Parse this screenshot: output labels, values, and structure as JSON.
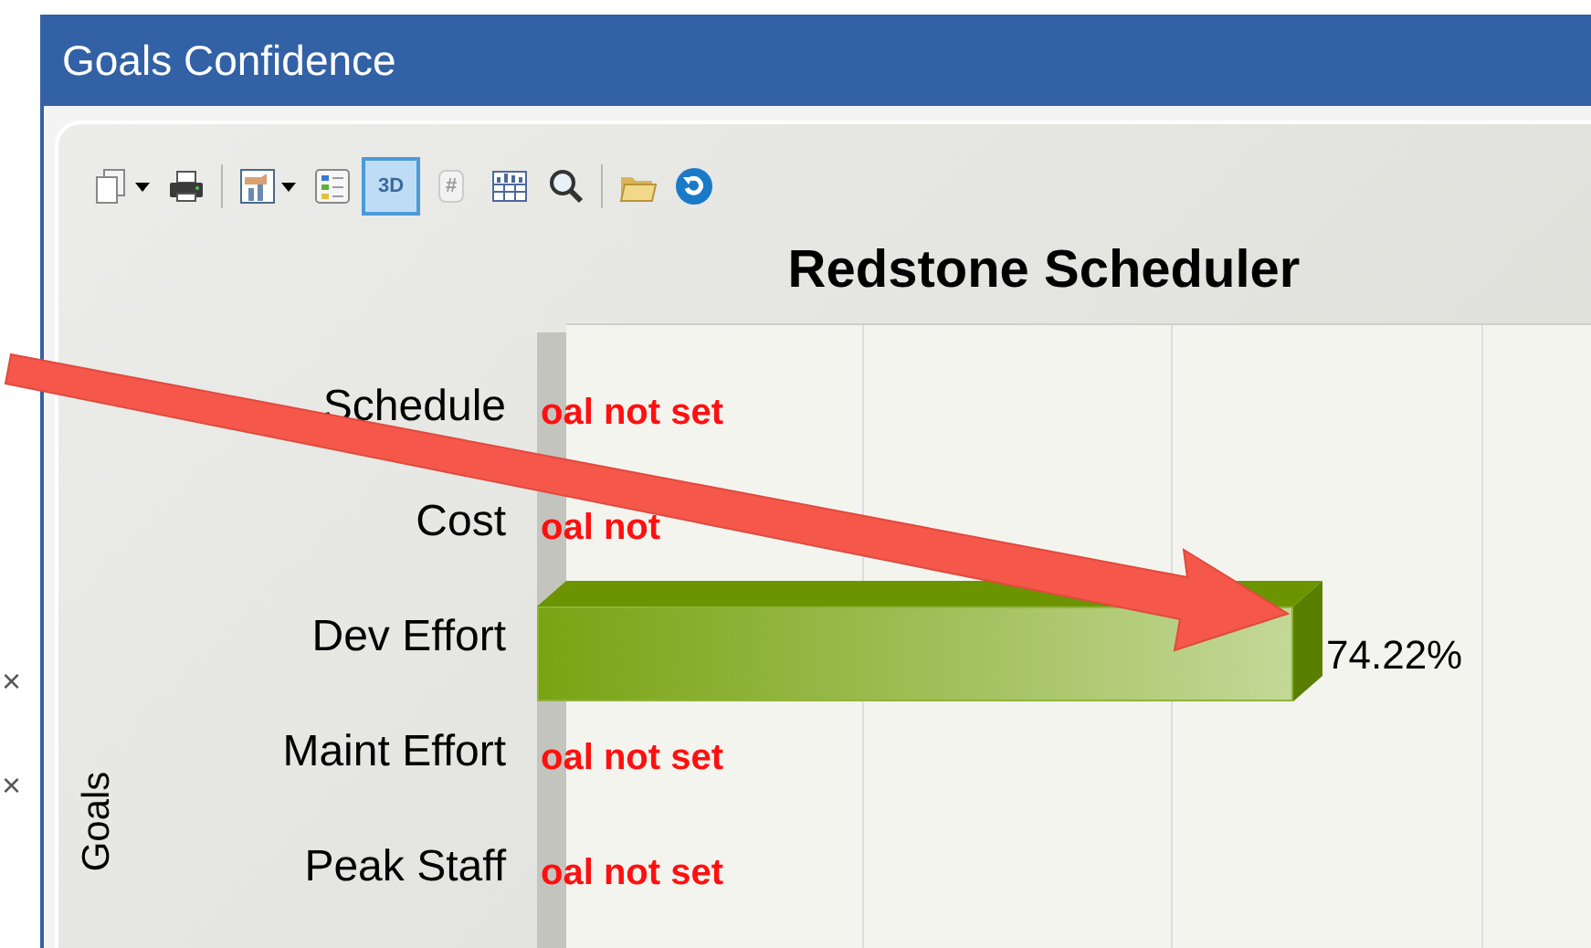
{
  "background_window": {
    "marks": [
      "×",
      "×"
    ]
  },
  "window": {
    "title": "Goals Confidence"
  },
  "toolbar": [
    {
      "kind": "copy",
      "dropdown": true
    },
    {
      "kind": "print",
      "dropdown": false
    },
    {
      "kind": "separator"
    },
    {
      "kind": "chart_type",
      "dropdown": true
    },
    {
      "kind": "legend",
      "dropdown": false
    },
    {
      "kind": "toggle",
      "label": "3D",
      "selected": true
    },
    {
      "kind": "toggle",
      "label": "#",
      "selected": false
    },
    {
      "kind": "data_table",
      "dropdown": false
    },
    {
      "kind": "zoom",
      "dropdown": false
    },
    {
      "kind": "separator"
    },
    {
      "kind": "open",
      "dropdown": false
    },
    {
      "kind": "refresh",
      "dropdown": false
    }
  ],
  "chart": {
    "title": "Redstone Scheduler",
    "ylabel": "Goals",
    "rows": [
      {
        "label": "Schedule",
        "kind": "not_set",
        "text": "oal not set"
      },
      {
        "label": "Cost",
        "kind": "not_set",
        "text": "oal not"
      },
      {
        "label": "Dev Effort",
        "kind": "bar",
        "text": "74.22%"
      },
      {
        "label": "Maint Effort",
        "kind": "not_set",
        "text": "oal not set"
      },
      {
        "label": "Peak Staff",
        "kind": "not_set",
        "text": "oal not set"
      }
    ]
  }
}
